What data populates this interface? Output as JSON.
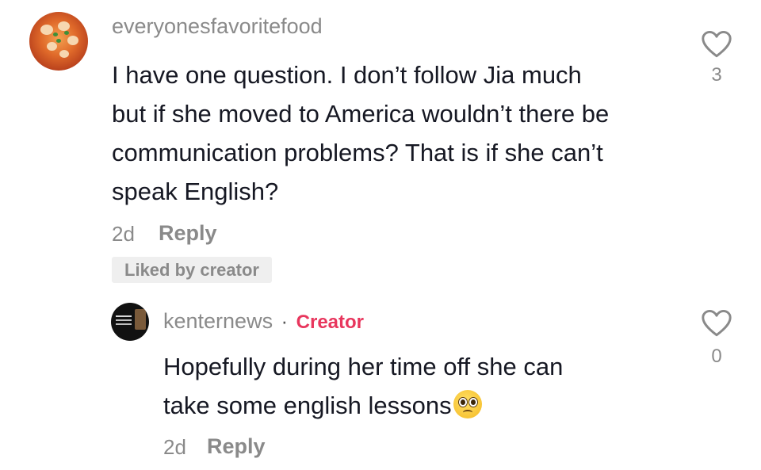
{
  "comment": {
    "username": "everyonesfavoritefood",
    "text_lines": [
      "I have one question. I don’t follow Jia much",
      "but if she moved to America wouldn’t there be",
      "communication problems? That is if she can’t",
      "speak English?"
    ],
    "time": "2d",
    "reply_label": "Reply",
    "liked_badge": "Liked by creator",
    "like_count": "3",
    "avatar_icon": "food-avatar"
  },
  "reply": {
    "username": "kenternews",
    "separator": "·",
    "creator_label": "Creator",
    "text_lines": [
      "Hopefully during her time off she can",
      "take some english lessons"
    ],
    "emoji": "pleading-face-emoji",
    "time": "2d",
    "reply_label": "Reply",
    "like_count": "0",
    "avatar_icon": "news-avatar"
  },
  "colors": {
    "text_primary": "#161823",
    "text_secondary": "#8a8a8a",
    "creator_accent": "#e8365d",
    "badge_bg": "#efefef"
  }
}
